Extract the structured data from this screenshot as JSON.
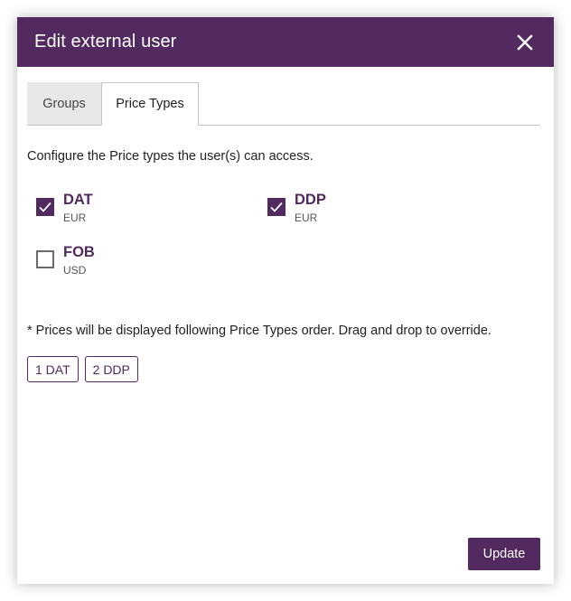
{
  "dialog": {
    "title": "Edit external user",
    "close_icon": "close-icon"
  },
  "tabs": [
    {
      "label": "Groups",
      "active": false
    },
    {
      "label": "Price Types",
      "active": true
    }
  ],
  "price_types": {
    "description": "Configure the Price types the user(s) can access.",
    "options": [
      {
        "name": "DAT",
        "currency": "EUR",
        "checked": true
      },
      {
        "name": "DDP",
        "currency": "EUR",
        "checked": true
      },
      {
        "name": "FOB",
        "currency": "USD",
        "checked": false
      }
    ],
    "order_note": "* Prices will be displayed following Price Types order. Drag and drop to override.",
    "order": [
      "1 DAT",
      "2 DDP"
    ]
  },
  "footer": {
    "update_label": "Update"
  },
  "colors": {
    "brand": "#532a5f",
    "tab_inactive": "#e8e8e8"
  }
}
